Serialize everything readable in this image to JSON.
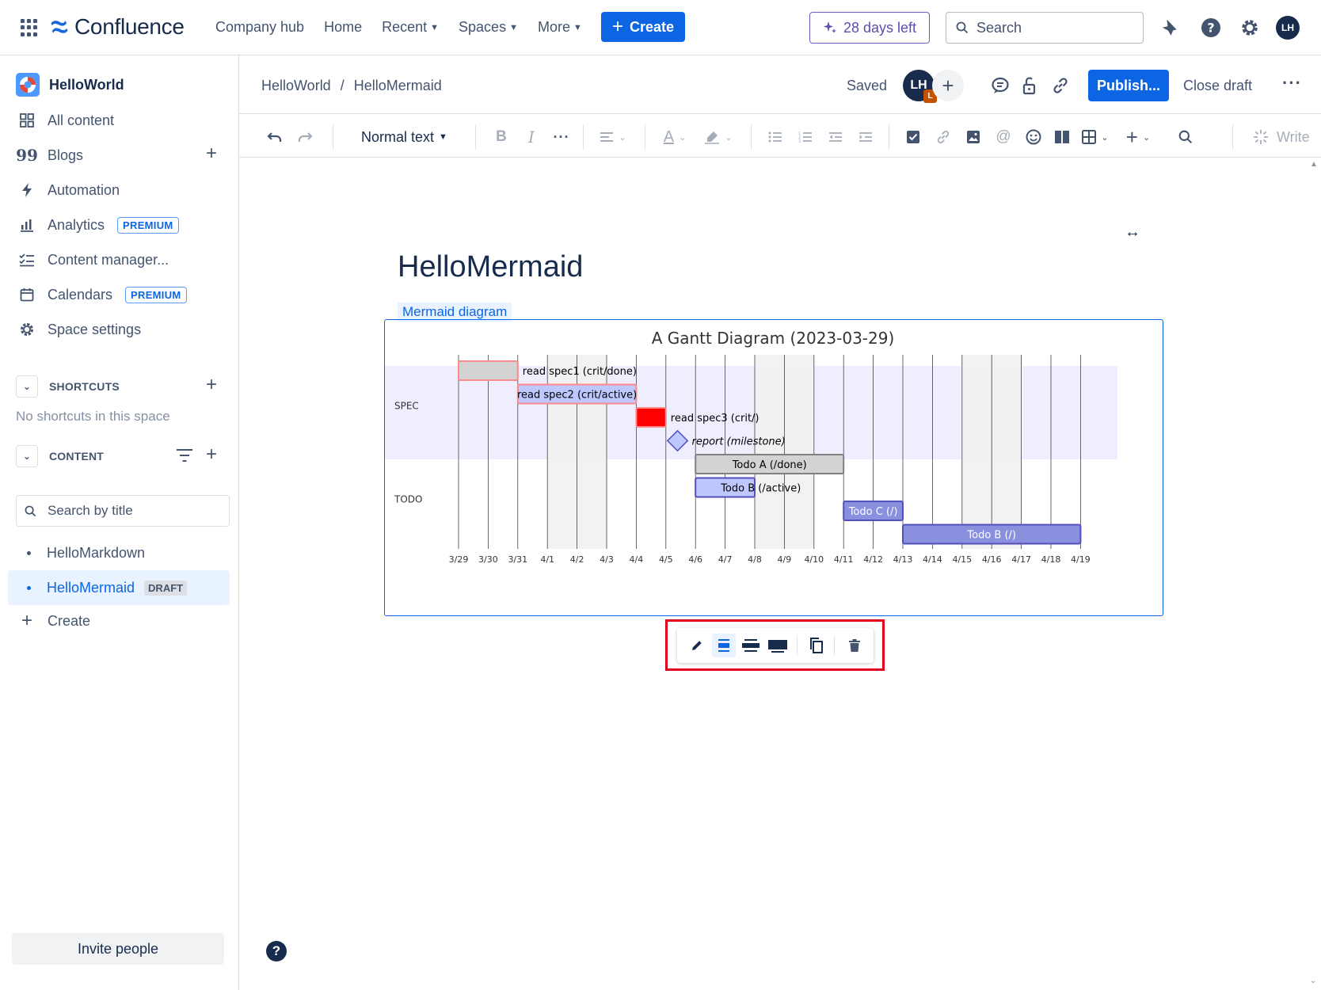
{
  "topnav": {
    "brand": "Confluence",
    "links": [
      {
        "label": "Company hub",
        "has_menu": false
      },
      {
        "label": "Home",
        "has_menu": false
      },
      {
        "label": "Recent",
        "has_menu": true
      },
      {
        "label": "Spaces",
        "has_menu": true
      },
      {
        "label": "More",
        "has_menu": true
      }
    ],
    "create_label": "Create",
    "trial_label": "28 days left",
    "search_placeholder": "Search",
    "avatar_initials": "LH",
    "icons": [
      "apps-grid-icon",
      "notifications-icon",
      "help-icon",
      "settings-icon"
    ]
  },
  "sidebar": {
    "space_name": "HelloWorld",
    "items": [
      {
        "label": "All content",
        "icon": "all-content-icon"
      },
      {
        "label": "Blogs",
        "icon": "blogs-icon"
      },
      {
        "label": "Automation",
        "icon": "automation-icon"
      },
      {
        "label": "Analytics",
        "icon": "analytics-icon",
        "badge": "PREMIUM"
      },
      {
        "label": "Content manager...",
        "icon": "content-manager-icon"
      },
      {
        "label": "Calendars",
        "icon": "calendar-icon",
        "badge": "PREMIUM"
      },
      {
        "label": "Space settings",
        "icon": "settings-icon"
      }
    ],
    "shortcuts_heading": "SHORTCUTS",
    "shortcuts_empty": "No shortcuts in this space",
    "content_heading": "CONTENT",
    "content_search_placeholder": "Search by title",
    "pages": [
      {
        "label": "HelloMarkdown",
        "active": false
      },
      {
        "label": "HelloMermaid",
        "active": true,
        "badge": "DRAFT"
      }
    ],
    "create_label": "Create",
    "invite_label": "Invite people"
  },
  "editor": {
    "breadcrumb": [
      "HelloWorld",
      "HelloMermaid"
    ],
    "breadcrumb_sep": "/",
    "saved_label": "Saved",
    "collab_initials": "LH",
    "collab_badge": "L",
    "publish_label": "Publish...",
    "close_draft_label": "Close draft",
    "more_label": "···"
  },
  "toolbar": {
    "text_style": "Normal text",
    "write_label": "Write"
  },
  "page": {
    "title": "HelloMermaid",
    "macro_label": "Mermaid diagram"
  },
  "colors": {
    "accent": "#0c66e4",
    "trial": "#6e5dc6",
    "highlight_outline": "#e2001a"
  },
  "chart_data": {
    "type": "gantt",
    "title": "A Gantt Diagram (2023-03-29)",
    "x_ticks": [
      "3/29",
      "3/30",
      "3/31",
      "4/1",
      "4/2",
      "4/3",
      "4/4",
      "4/5",
      "4/6",
      "4/7",
      "4/8",
      "4/9",
      "4/10",
      "4/11",
      "4/12",
      "4/13",
      "4/14",
      "4/15",
      "4/16",
      "4/17",
      "4/18",
      "4/19"
    ],
    "sections": [
      {
        "name": "SPEC",
        "tasks": [
          0,
          1,
          2,
          3
        ]
      },
      {
        "name": "TODO",
        "tasks": [
          4,
          5,
          6,
          7
        ]
      }
    ],
    "tasks": [
      {
        "label": "read spec1 (crit/done)",
        "start": 0,
        "end": 2,
        "status": "crit-done",
        "label_pos": "right"
      },
      {
        "label": "read spec2 (crit/active)",
        "start": 2,
        "end": 6,
        "status": "crit-active",
        "label_pos": "inside"
      },
      {
        "label": "read spec3 (crit/)",
        "start": 6,
        "end": 7,
        "status": "crit",
        "label_pos": "right"
      },
      {
        "label": "report (milestone)",
        "start": 7.5,
        "end": 7.5,
        "status": "milestone",
        "label_pos": "right"
      },
      {
        "label": "Todo A (/done)",
        "start": 8,
        "end": 13,
        "status": "done",
        "label_pos": "inside"
      },
      {
        "label": "Todo B (/active)",
        "start": 8,
        "end": 10,
        "status": "active",
        "label_pos": "overflow"
      },
      {
        "label": "Todo C (/)",
        "start": 13,
        "end": 15,
        "status": "normal",
        "label_pos": "inside"
      },
      {
        "label": "Todo B (/)",
        "start": 15,
        "end": 21,
        "status": "normal",
        "label_pos": "inside"
      }
    ],
    "weekend_columns": [
      3,
      4,
      10,
      11,
      17,
      18
    ],
    "colors": {
      "section_bg": "#eeeeff",
      "weekend_bg": "#f1f1f1",
      "done": "#d3d3d3",
      "active": "#bfc7ff",
      "normal": "#8a90dd",
      "crit_stroke": "#ff8888",
      "crit_fill": "#ff0000",
      "normal_stroke": "#534fbc"
    }
  }
}
